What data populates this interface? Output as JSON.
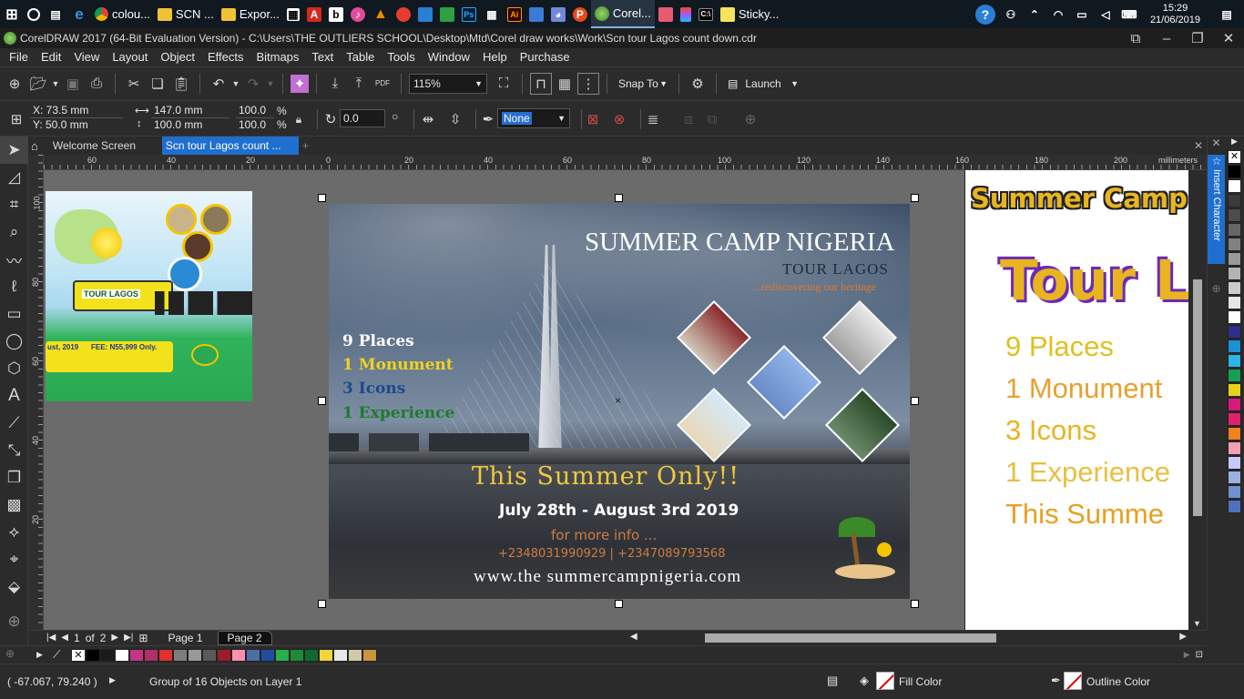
{
  "taskbar": {
    "apps": [
      {
        "label": "colou...",
        "icon": "chrome-icon"
      },
      {
        "label": "SCN ...",
        "icon": "folder-icon"
      },
      {
        "label": "Expor...",
        "icon": "folder-icon"
      },
      {
        "label": "Corel...",
        "icon": "coreldraw-icon"
      },
      {
        "label": "Sticky...",
        "icon": "sticky-notes-icon"
      }
    ],
    "time": "15:29",
    "date": "21/06/2019"
  },
  "window": {
    "title": "CorelDRAW 2017 (64-Bit Evaluation Version) - C:\\Users\\THE OUTLIERS SCHOOL\\Desktop\\Mtd\\Corel draw works\\Work\\Scn tour Lagos count down.cdr"
  },
  "menu": [
    "File",
    "Edit",
    "View",
    "Layout",
    "Object",
    "Effects",
    "Bitmaps",
    "Text",
    "Table",
    "Tools",
    "Window",
    "Help",
    "Purchase"
  ],
  "toolbar": {
    "zoom": "115%",
    "snap_to": "Snap To",
    "launch": "Launch"
  },
  "propbar": {
    "x": "X: 73.5 mm",
    "y": "Y: 50.0 mm",
    "w": "147.0 mm",
    "h": "100.0 mm",
    "sx": "100.0",
    "sy": "100.0",
    "pct": "%",
    "angle": "0.0",
    "outline": "None"
  },
  "tabs": [
    "Welcome Screen",
    "Scn tour Lagos count ..."
  ],
  "ruler": {
    "h_labels": [
      "60",
      "40",
      "20",
      "0",
      "20",
      "40",
      "60",
      "80",
      "100",
      "120",
      "140",
      "160",
      "180",
      "200"
    ],
    "unit": "millimeters",
    "v_labels": [
      "100",
      "80",
      "60",
      "40",
      "20"
    ]
  },
  "poster": {
    "title": "SUMMER CAMP NIGERIA",
    "subtitle": "TOUR LAGOS",
    "tagline": "...rediscovering our heritage",
    "list": [
      "9 Places",
      "1 Monument",
      "3 Icons",
      "1 Experience"
    ],
    "headline": "This Summer Only!!",
    "dates": "July 28th - August 3rd 2019",
    "more": "for more info ...",
    "phones": "+2348031990929  |  +2347089793568",
    "website": "www.the summercampnigeria.com"
  },
  "thumb_left": {
    "tour": "TOUR LAGOS",
    "fee": "FEE: N55,999 Only.",
    "year": "ust, 2019"
  },
  "preview_right": {
    "title": "Summer Camp",
    "big": "Tour La",
    "lines": [
      "9 Places",
      "1 Monument",
      "3 Icons",
      "1 Experience",
      "This Summe"
    ]
  },
  "pages": {
    "current": "1",
    "of": "of",
    "total": "2",
    "tabs": [
      "Page 1",
      "Page 2"
    ]
  },
  "docker": {
    "label": "Insert Character"
  },
  "palette": [
    "#ffffff",
    "#000000",
    "#1a1a1a",
    "#ffffff",
    "#c13584",
    "#b0306a",
    "#e03030",
    "#7d7d7d",
    "#999999",
    "#5a5a5a",
    "#9b1d2a",
    "#ff8fb0",
    "#4a6fa5",
    "#1f4e9e",
    "#2ab04a",
    "#1e8a3a",
    "#106a2e",
    "#f2d43c",
    "#e8e8e8",
    "#d2c9a8",
    "#c9963c"
  ],
  "rpalette": [
    "#000000",
    "#ffffff",
    "#3a3a3a",
    "#4d4d4d",
    "#666666",
    "#808080",
    "#999999",
    "#b3b3b3",
    "#cccccc",
    "#e6e6e6",
    "#ffffff",
    "#2d2d8c",
    "#1e90d6",
    "#2bb5e8",
    "#14a050",
    "#e6d21e",
    "#d8197a",
    "#e0226a",
    "#f08020",
    "#f4a0b0",
    "#c8c8ff",
    "#9ab0e0",
    "#7090d0",
    "#5070c0",
    "#3050a0",
    "#203080"
  ],
  "status": {
    "coords": "( -67.067, 79.240 )",
    "selection": "Group of 16 Objects on Layer 1",
    "fill": "Fill Color",
    "outline": "Outline Color"
  }
}
